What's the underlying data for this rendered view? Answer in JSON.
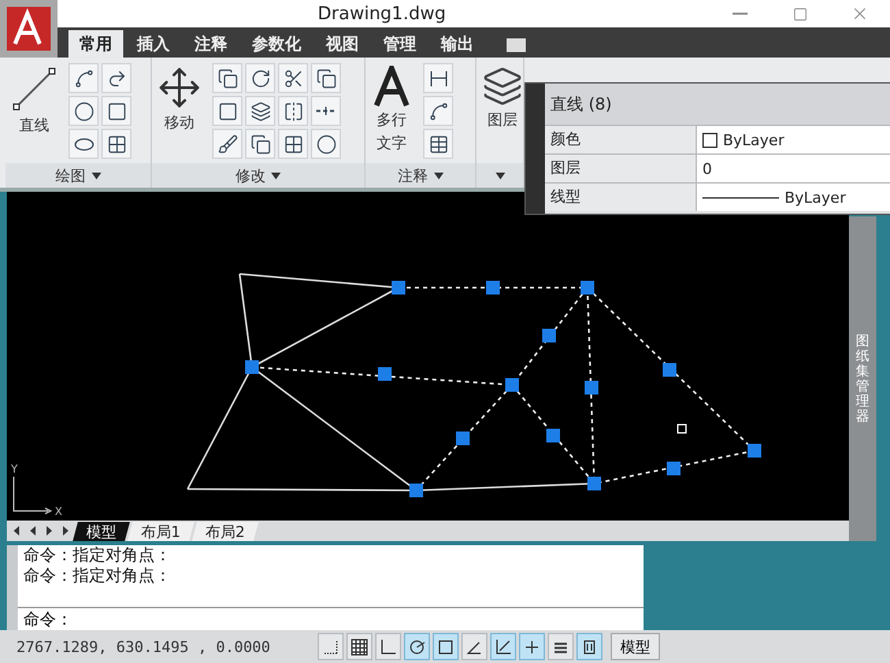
{
  "window": {
    "title": "Drawing1.dwg"
  },
  "ribbon_tabs": [
    {
      "label": "常用",
      "selected": true
    },
    {
      "label": "插入",
      "selected": false
    },
    {
      "label": "注释",
      "selected": false
    },
    {
      "label": "参数化",
      "selected": false
    },
    {
      "label": "视图",
      "selected": false
    },
    {
      "label": "管理",
      "selected": false
    },
    {
      "label": "输出",
      "selected": false
    }
  ],
  "ribbon_panels": [
    {
      "kind": "draw",
      "title": "绘图",
      "tool_label": "直线"
    },
    {
      "kind": "modify",
      "title": "修改",
      "tool_label": "移动"
    },
    {
      "kind": "annotate",
      "title": "注释",
      "tool_label_lines": [
        "多行",
        "文字"
      ]
    },
    {
      "kind": "layers",
      "tool_label": "图层"
    }
  ],
  "properties_palette": {
    "title": "直线 (8)",
    "rows": [
      {
        "kind": "color",
        "name": "颜色",
        "value": "ByLayer"
      },
      {
        "kind": "text",
        "name": "图层",
        "value": "0"
      },
      {
        "kind": "linetype",
        "name": "线型",
        "value": "ByLayer"
      }
    ]
  },
  "ucs": {
    "y_label": "Y",
    "x_label": "X"
  },
  "layout_tabs": [
    {
      "label": "模型",
      "selected": true
    },
    {
      "label": "布局1",
      "selected": false
    },
    {
      "label": "布局2",
      "selected": false
    }
  ],
  "side_palette": {
    "label": "图纸集管理器"
  },
  "command_line": {
    "history": [
      "命令：指定对角点：",
      "命令：指定对角点："
    ],
    "prompt": "命令："
  },
  "status_bar": {
    "coordinates": "2767.1289, 630.1495 , 0.0000",
    "toggles": [
      {
        "kind": "snap",
        "on": false
      },
      {
        "kind": "grid",
        "on": false
      },
      {
        "kind": "ortho",
        "on": false
      },
      {
        "kind": "polar",
        "on": true
      },
      {
        "kind": "osnap",
        "on": true
      },
      {
        "kind": "otrack",
        "on": false
      },
      {
        "kind": "ducs",
        "on": true
      },
      {
        "kind": "dyn",
        "on": true
      },
      {
        "kind": "lweight",
        "on": false
      },
      {
        "kind": "qp",
        "on": true
      }
    ],
    "space_button": "模型"
  }
}
